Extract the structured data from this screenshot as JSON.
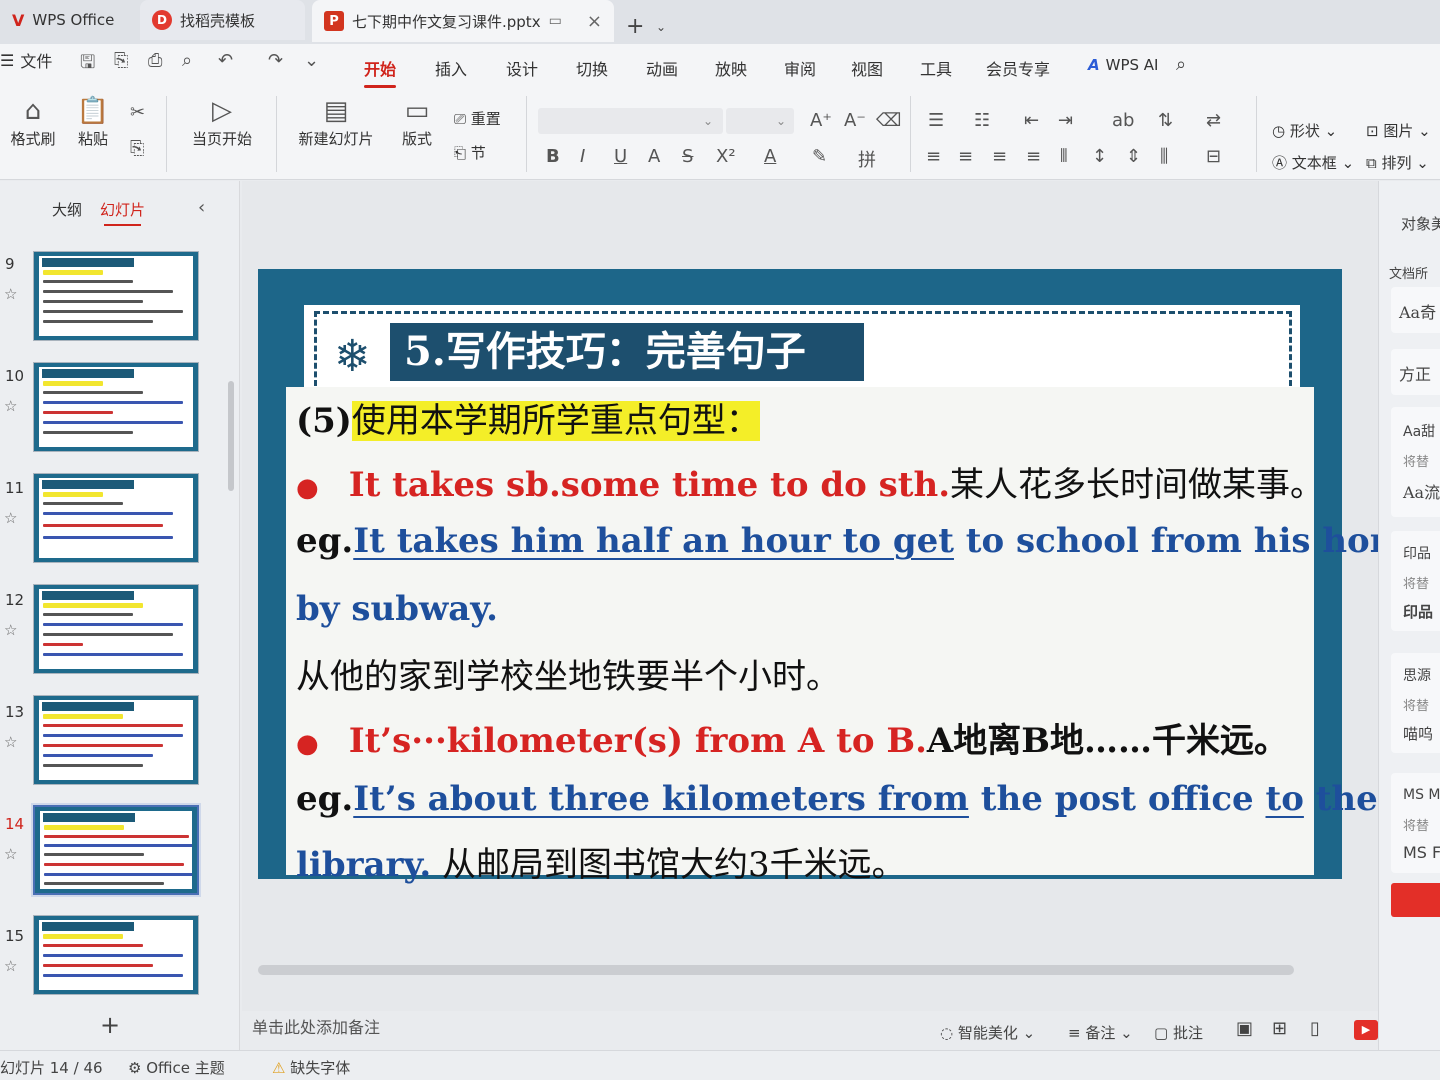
{
  "tabs": {
    "wps_office": "WPS Office",
    "template": "找稻壳模板",
    "document": "七下期中作文复习课件.pptx"
  },
  "menu": {
    "file": "文件",
    "tabs": [
      "开始",
      "插入",
      "设计",
      "切换",
      "动画",
      "放映",
      "审阅",
      "视图",
      "工具",
      "会员专享"
    ],
    "active_tab": "开始",
    "wps_ai": "WPS AI"
  },
  "ribbon": {
    "format_painter": "格式刷",
    "paste": "粘贴",
    "play_current": "当页开始",
    "new_slide": "新建幻灯片",
    "layout": "版式",
    "reset": "重置",
    "section": "节",
    "shape": "形状",
    "picture": "图片",
    "textbox": "文本框",
    "arrange": "排列"
  },
  "left_panel": {
    "tab_outline": "大纲",
    "tab_slides": "幻灯片",
    "active_tab": "幻灯片",
    "slide_numbers": [
      "9",
      "10",
      "11",
      "12",
      "13",
      "14",
      "15"
    ],
    "selected_slide": "14"
  },
  "slide": {
    "title": "5.写作技巧：完善句子",
    "heading_num": "(5)",
    "heading": "使用本学期所学重点句型：",
    "p1_en": "It takes sb.some time to do sth.",
    "p1_cn": "某人花多长时间做某事。",
    "eg1_prefix": "eg.",
    "eg1_underlined": "It takes him half an hour to get",
    "eg1_rest": " to school from his home",
    "eg1_line2": "by subway.",
    "eg1_cn": "从他的家到学校坐地铁要半个小时。",
    "p2_en": "It’s···kilometer(s) from A to B.",
    "p2_cn": "A地离B地……千米远。",
    "eg2_prefix": "eg.",
    "eg2_underlined": "It’s about three kilometers from",
    "eg2_mid": " the post office ",
    "eg2_to": "to",
    "eg2_the": " the",
    "eg2_line2": "library.",
    "eg2_cn": " 从邮局到图书馆大约3千米远。"
  },
  "notes_placeholder": "单击此处添加备注",
  "right_panel": {
    "label_object": "对象美",
    "label_doc": "文档所",
    "items": [
      "Aa奇",
      "方正",
      "Aa甜",
      "将替",
      "Aa流",
      "印品",
      "将替",
      "印品",
      "思源",
      "将替",
      "喵呜",
      "MS M",
      "将替",
      "MS F"
    ]
  },
  "view_bar": {
    "smart_beautify": "智能美化",
    "notes": "备注",
    "comment": "批注"
  },
  "status_bar": {
    "slide_counter": "幻灯片 14 / 46",
    "theme": "Office 主题",
    "missing_font": "缺失字体"
  },
  "colors": {
    "accent": "#d0241c",
    "slide_frame": "#1d6689",
    "title_bg": "#1d4f6e",
    "highlight": "#f4ee28",
    "red_text": "#d62422",
    "blue_text": "#1e4f9c"
  }
}
